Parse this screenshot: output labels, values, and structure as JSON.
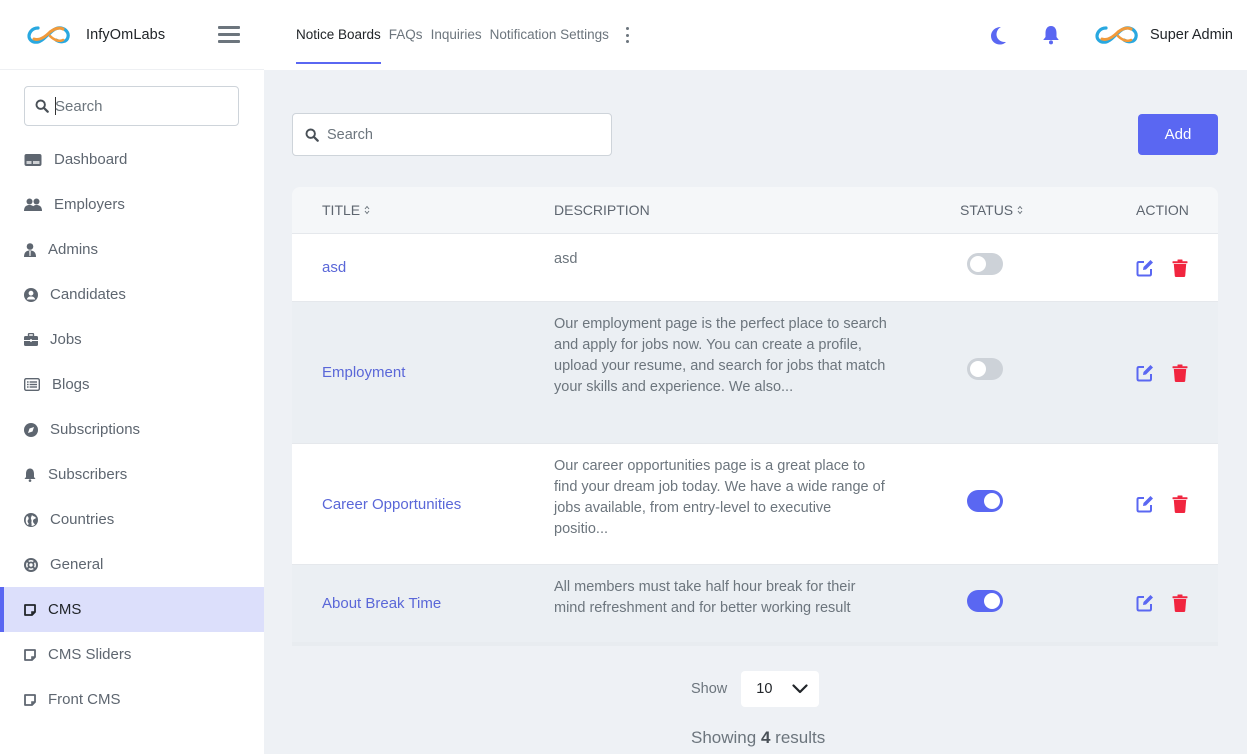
{
  "brand": {
    "name": "InfyOmLabs"
  },
  "sidebar": {
    "search_placeholder": "Search",
    "items": [
      {
        "label": "Dashboard",
        "icon": "dashboard-icon",
        "active": false
      },
      {
        "label": "Employers",
        "icon": "users-icon",
        "active": false
      },
      {
        "label": "Admins",
        "icon": "admin-icon",
        "active": false
      },
      {
        "label": "Candidates",
        "icon": "user-circle-icon",
        "active": false
      },
      {
        "label": "Jobs",
        "icon": "briefcase-icon",
        "active": false
      },
      {
        "label": "Blogs",
        "icon": "list-icon",
        "active": false
      },
      {
        "label": "Subscriptions",
        "icon": "compass-icon",
        "active": false
      },
      {
        "label": "Subscribers",
        "icon": "bell-icon",
        "active": false
      },
      {
        "label": "Countries",
        "icon": "globe-icon",
        "active": false
      },
      {
        "label": "General",
        "icon": "lifebuoy-icon",
        "active": false
      },
      {
        "label": "CMS",
        "icon": "note-icon",
        "active": true
      },
      {
        "label": "CMS Sliders",
        "icon": "note-icon",
        "active": false
      },
      {
        "label": "Front CMS",
        "icon": "note-icon",
        "active": false
      }
    ]
  },
  "header": {
    "tabs": [
      {
        "label": "Notice Boards",
        "active": true
      },
      {
        "label": "FAQs",
        "active": false
      },
      {
        "label": "Inquiries",
        "active": false
      },
      {
        "label": "Notification Settings",
        "active": false
      }
    ],
    "user_name": "Super Admin"
  },
  "main": {
    "search_placeholder": "Search",
    "add_label": "Add",
    "table": {
      "columns": [
        "TITLE",
        "DESCRIPTION",
        "STATUS",
        "ACTION"
      ],
      "rows": [
        {
          "title": "asd",
          "description": "asd",
          "status": false
        },
        {
          "title": "Employment",
          "description": "Our employment page is the perfect place to search and apply for jobs now. You can create a profile, upload your resume, and search for jobs that match your skills and experience. We also...",
          "status": false
        },
        {
          "title": "Career Opportunities",
          "description": "Our career opportunities page is a great place to find your dream job today. We have a wide range of jobs available, from entry-level to executive positio...",
          "status": true
        },
        {
          "title": "About Break Time",
          "description": "All members must take half hour break for their mind refreshment and for better working result",
          "status": true
        }
      ]
    },
    "pagination": {
      "show_label": "Show",
      "per_page": "10",
      "showing_prefix": "Showing",
      "showing_count": "4",
      "showing_suffix": "results"
    }
  },
  "colors": {
    "accent": "#5a67f2",
    "danger": "#f1253f",
    "sidebar_active_bg": "#dcdffb",
    "page_bg": "#eef1f5"
  }
}
